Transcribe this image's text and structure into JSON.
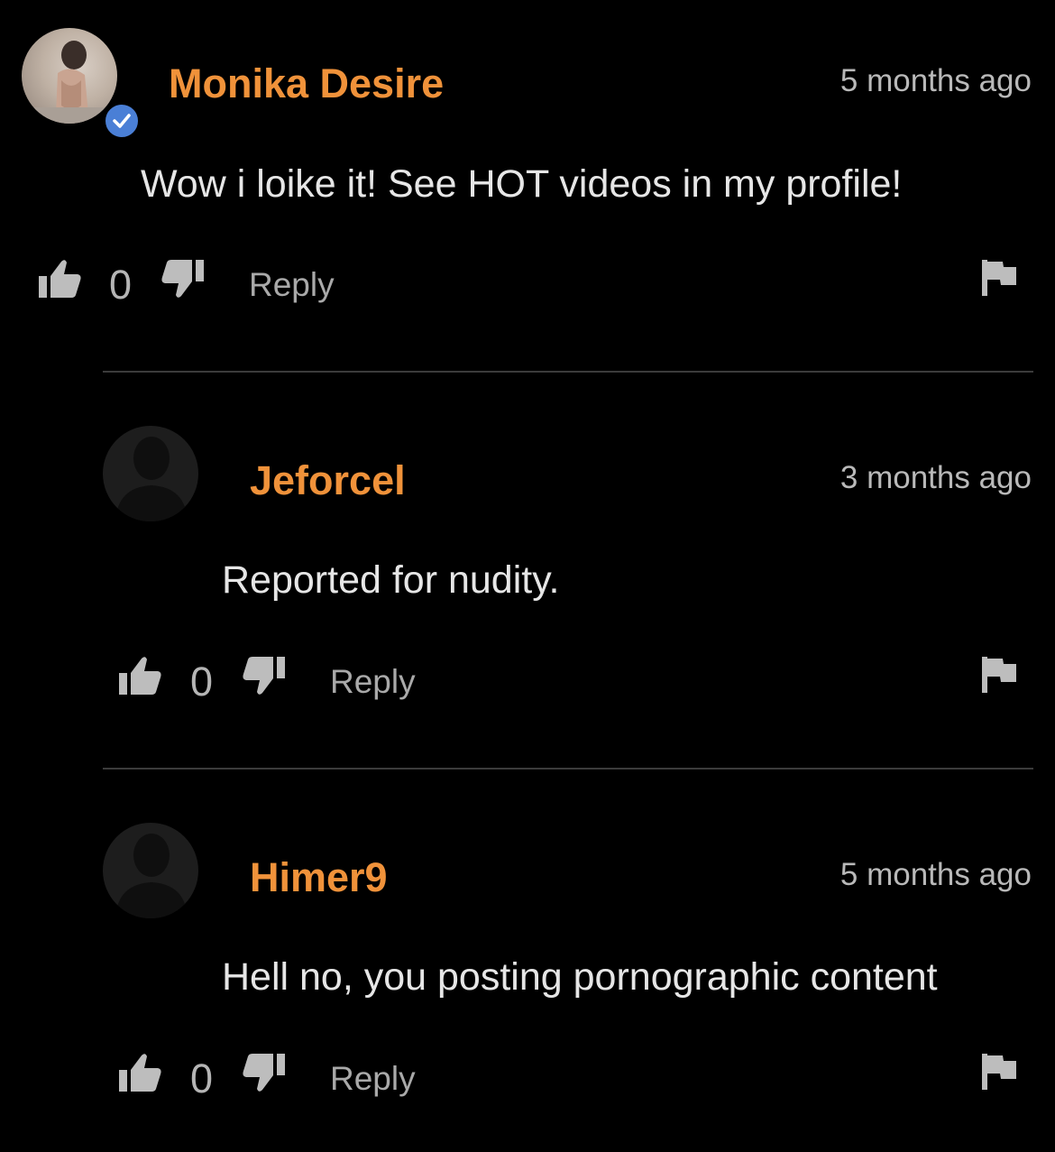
{
  "theme": {
    "background": "#000000",
    "username_color": "#f0923a",
    "verified_color": "#4a7fd6"
  },
  "comments": [
    {
      "username": "Monika Desire",
      "timestamp": "5 months ago",
      "text": "Wow i loike it! See HOT videos in my profile!",
      "votes": "0",
      "reply_label": "Reply",
      "verified": true,
      "avatar": "profile-photo"
    },
    {
      "username": "Jeforcel",
      "timestamp": "3 months ago",
      "text": "Reported for nudity.",
      "votes": "0",
      "reply_label": "Reply",
      "verified": false,
      "avatar": "default-user-icon"
    },
    {
      "username": "Himer9",
      "timestamp": "5 months ago",
      "text": "Hell no, you posting pornographic content",
      "votes": "0",
      "reply_label": "Reply",
      "verified": false,
      "avatar": "default-user-icon"
    }
  ],
  "icons": {
    "like": "thumbs-up-icon",
    "dislike": "thumbs-down-icon",
    "report": "flag-icon",
    "verified": "verified-check-icon"
  }
}
